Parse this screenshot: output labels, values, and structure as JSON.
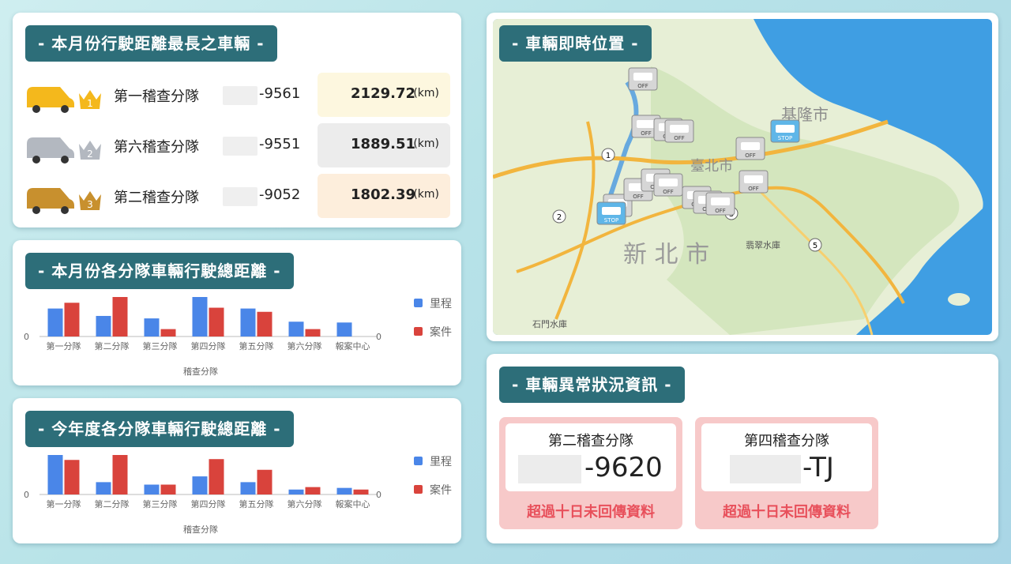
{
  "top_vehicles": {
    "title": "- 本月份行駛距離最長之車輛 -",
    "rows": [
      {
        "rank": "1",
        "team": "第一稽查分隊",
        "plate": "-9561",
        "distance": "2129.72",
        "unit": "(km)",
        "color": "#f4b81c",
        "box": "#fdf7df"
      },
      {
        "rank": "2",
        "team": "第六稽查分隊",
        "plate": "-9551",
        "distance": "1889.51",
        "unit": "(km)",
        "color": "#b3b8c0",
        "box": "#ececec"
      },
      {
        "rank": "3",
        "team": "第二稽查分隊",
        "plate": "-9052",
        "distance": "1802.39",
        "unit": "(km)",
        "color": "#c8902e",
        "box": "#fdeedc"
      }
    ]
  },
  "monthly_chart": {
    "title": "- 本月份各分隊車輛行駛總距離 -",
    "xlabel": "稽查分隊",
    "zero_left": "0",
    "zero_right": "0"
  },
  "yearly_chart": {
    "title": "- 今年度各分隊車輛行駛總距離 -",
    "xlabel": "稽查分隊",
    "zero_left": "0",
    "zero_right": "0"
  },
  "chart_data": [
    {
      "type": "bar",
      "categories": [
        "第一分隊",
        "第二分隊",
        "第三分隊",
        "第四分隊",
        "第五分隊",
        "第六分隊",
        "報案中心"
      ],
      "series": [
        {
          "name": "里程",
          "color": "#4a86e8",
          "values": [
            34,
            25,
            22,
            48,
            34,
            18,
            17
          ]
        },
        {
          "name": "案件",
          "color": "#d9433c",
          "values": [
            41,
            48,
            9,
            35,
            30,
            9,
            0
          ]
        }
      ],
      "xlabel": "稽查分隊",
      "legend": "right"
    },
    {
      "type": "bar",
      "categories": [
        "第一分隊",
        "第二分隊",
        "第三分隊",
        "第四分隊",
        "第五分隊",
        "第六分隊",
        "報案中心"
      ],
      "series": [
        {
          "name": "里程",
          "color": "#4a86e8",
          "values": [
            48,
            15,
            12,
            22,
            15,
            6,
            8
          ]
        },
        {
          "name": "案件",
          "color": "#d9433c",
          "values": [
            42,
            48,
            12,
            43,
            30,
            9,
            6
          ]
        }
      ],
      "xlabel": "稽查分隊",
      "legend": "right"
    }
  ],
  "map": {
    "title": "- 車輛即時位置 -",
    "labels": [
      "基隆市",
      "臺北市",
      "新 北 市",
      "翡翠水庫",
      "石門水庫"
    ],
    "road_numbers": [
      "1",
      "2",
      "3",
      "5"
    ],
    "markers": [
      "OFF",
      "STOP"
    ]
  },
  "alerts": {
    "title": "- 車輛異常狀況資訊 -",
    "items": [
      {
        "team": "第二稽查分隊",
        "plate": "-9620",
        "message": "超過十日未回傳資料"
      },
      {
        "team": "第四稽查分隊",
        "plate": "-TJ",
        "message": "超過十日未回傳資料"
      }
    ]
  }
}
